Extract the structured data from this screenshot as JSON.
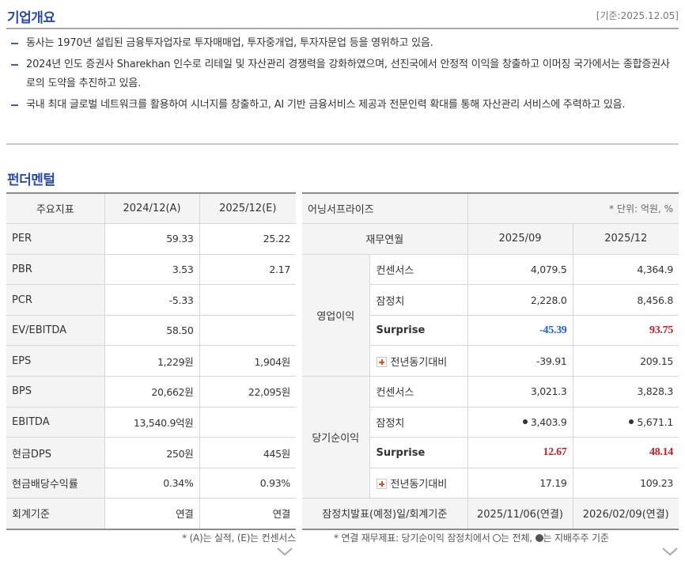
{
  "overview": {
    "title": "기업개요",
    "basis": "[기준:2025.12.05]",
    "bullets": [
      "동사는 1970년 설립된 금융투자업자로 투자매매업, 투자중개업, 투자자문업 등을 영위하고 있음.",
      "2024년 인도 증권사 Sharekhan 인수로 리테일 및 자산관리 경쟁력을 강화하였으며, 선진국에서 안정적 이익을 창출하고 이머징 국가에서는 종합증권사로의 도약을 추진하고 있음.",
      "국내 최대 글로벌 네트워크를 활용하여 시너지를 창출하고, AI 기반 금융서비스 제공과 전문인력 확대를 통해 자산관리 서비스에 주력하고 있음."
    ]
  },
  "fundamentals": {
    "title": "펀더멘털",
    "headers": [
      "주요지표",
      "2024/12(A)",
      "2025/12(E)"
    ],
    "rows": [
      [
        "PER",
        "59.33",
        "25.22"
      ],
      [
        "PBR",
        "3.53",
        "2.17"
      ],
      [
        "PCR",
        "-5.33",
        ""
      ],
      [
        "EV/EBITDA",
        "58.50",
        ""
      ],
      [
        "EPS",
        "1,229원",
        "1,904원"
      ],
      [
        "BPS",
        "20,662원",
        "22,095원"
      ],
      [
        "EBITDA",
        "13,540.9억원",
        ""
      ],
      [
        "현금DPS",
        "250원",
        "445원"
      ],
      [
        "현금배당수익률",
        "0.34%",
        "0.93%"
      ],
      [
        "회계기준",
        "연결",
        "연결"
      ]
    ],
    "note": "* (A)는 실적, (E)는 컨센서스"
  },
  "earnings": {
    "title": "어닝서프라이즈",
    "unit": "* 단위: 억원, %",
    "colheads": [
      "재무연월",
      "2025/09",
      "2025/12"
    ],
    "groups": [
      {
        "name": "영업이익",
        "rows": [
          {
            "label": "컨센서스",
            "v1": "4,079.5",
            "v2": "4,364.9"
          },
          {
            "label": "잠정치",
            "v1": "2,228.0",
            "v2": "8,456.8"
          },
          {
            "label": "Surprise",
            "v1": "-45.39",
            "v2": "93.75"
          },
          {
            "label": "전년동기대비",
            "v1": "-39.91",
            "v2": "209.15"
          }
        ]
      },
      {
        "name": "당기순이익",
        "rows": [
          {
            "label": "컨센서스",
            "v1": "3,021.3",
            "v2": "3,828.3"
          },
          {
            "label": "잠정치",
            "v1": "3,403.9",
            "v2": "5,671.1"
          },
          {
            "label": "Surprise",
            "v1": "12.67",
            "v2": "48.14"
          },
          {
            "label": "전년동기대비",
            "v1": "17.19",
            "v2": "109.23"
          }
        ]
      }
    ],
    "footer": {
      "label": "잠정치발표(예정)일/회계기준",
      "v1": "2025/11/06(연결)",
      "v2": "2026/02/09(연결)"
    },
    "note": {
      "prefix": "* 연결 재무제표: 당기순이익 잠정치에서",
      "open_text": "는 전체,",
      "fill_text": "는 지배주주 기준"
    },
    "colors": {
      "negative": "#1c5fd6",
      "positive": "#c0202a"
    }
  }
}
